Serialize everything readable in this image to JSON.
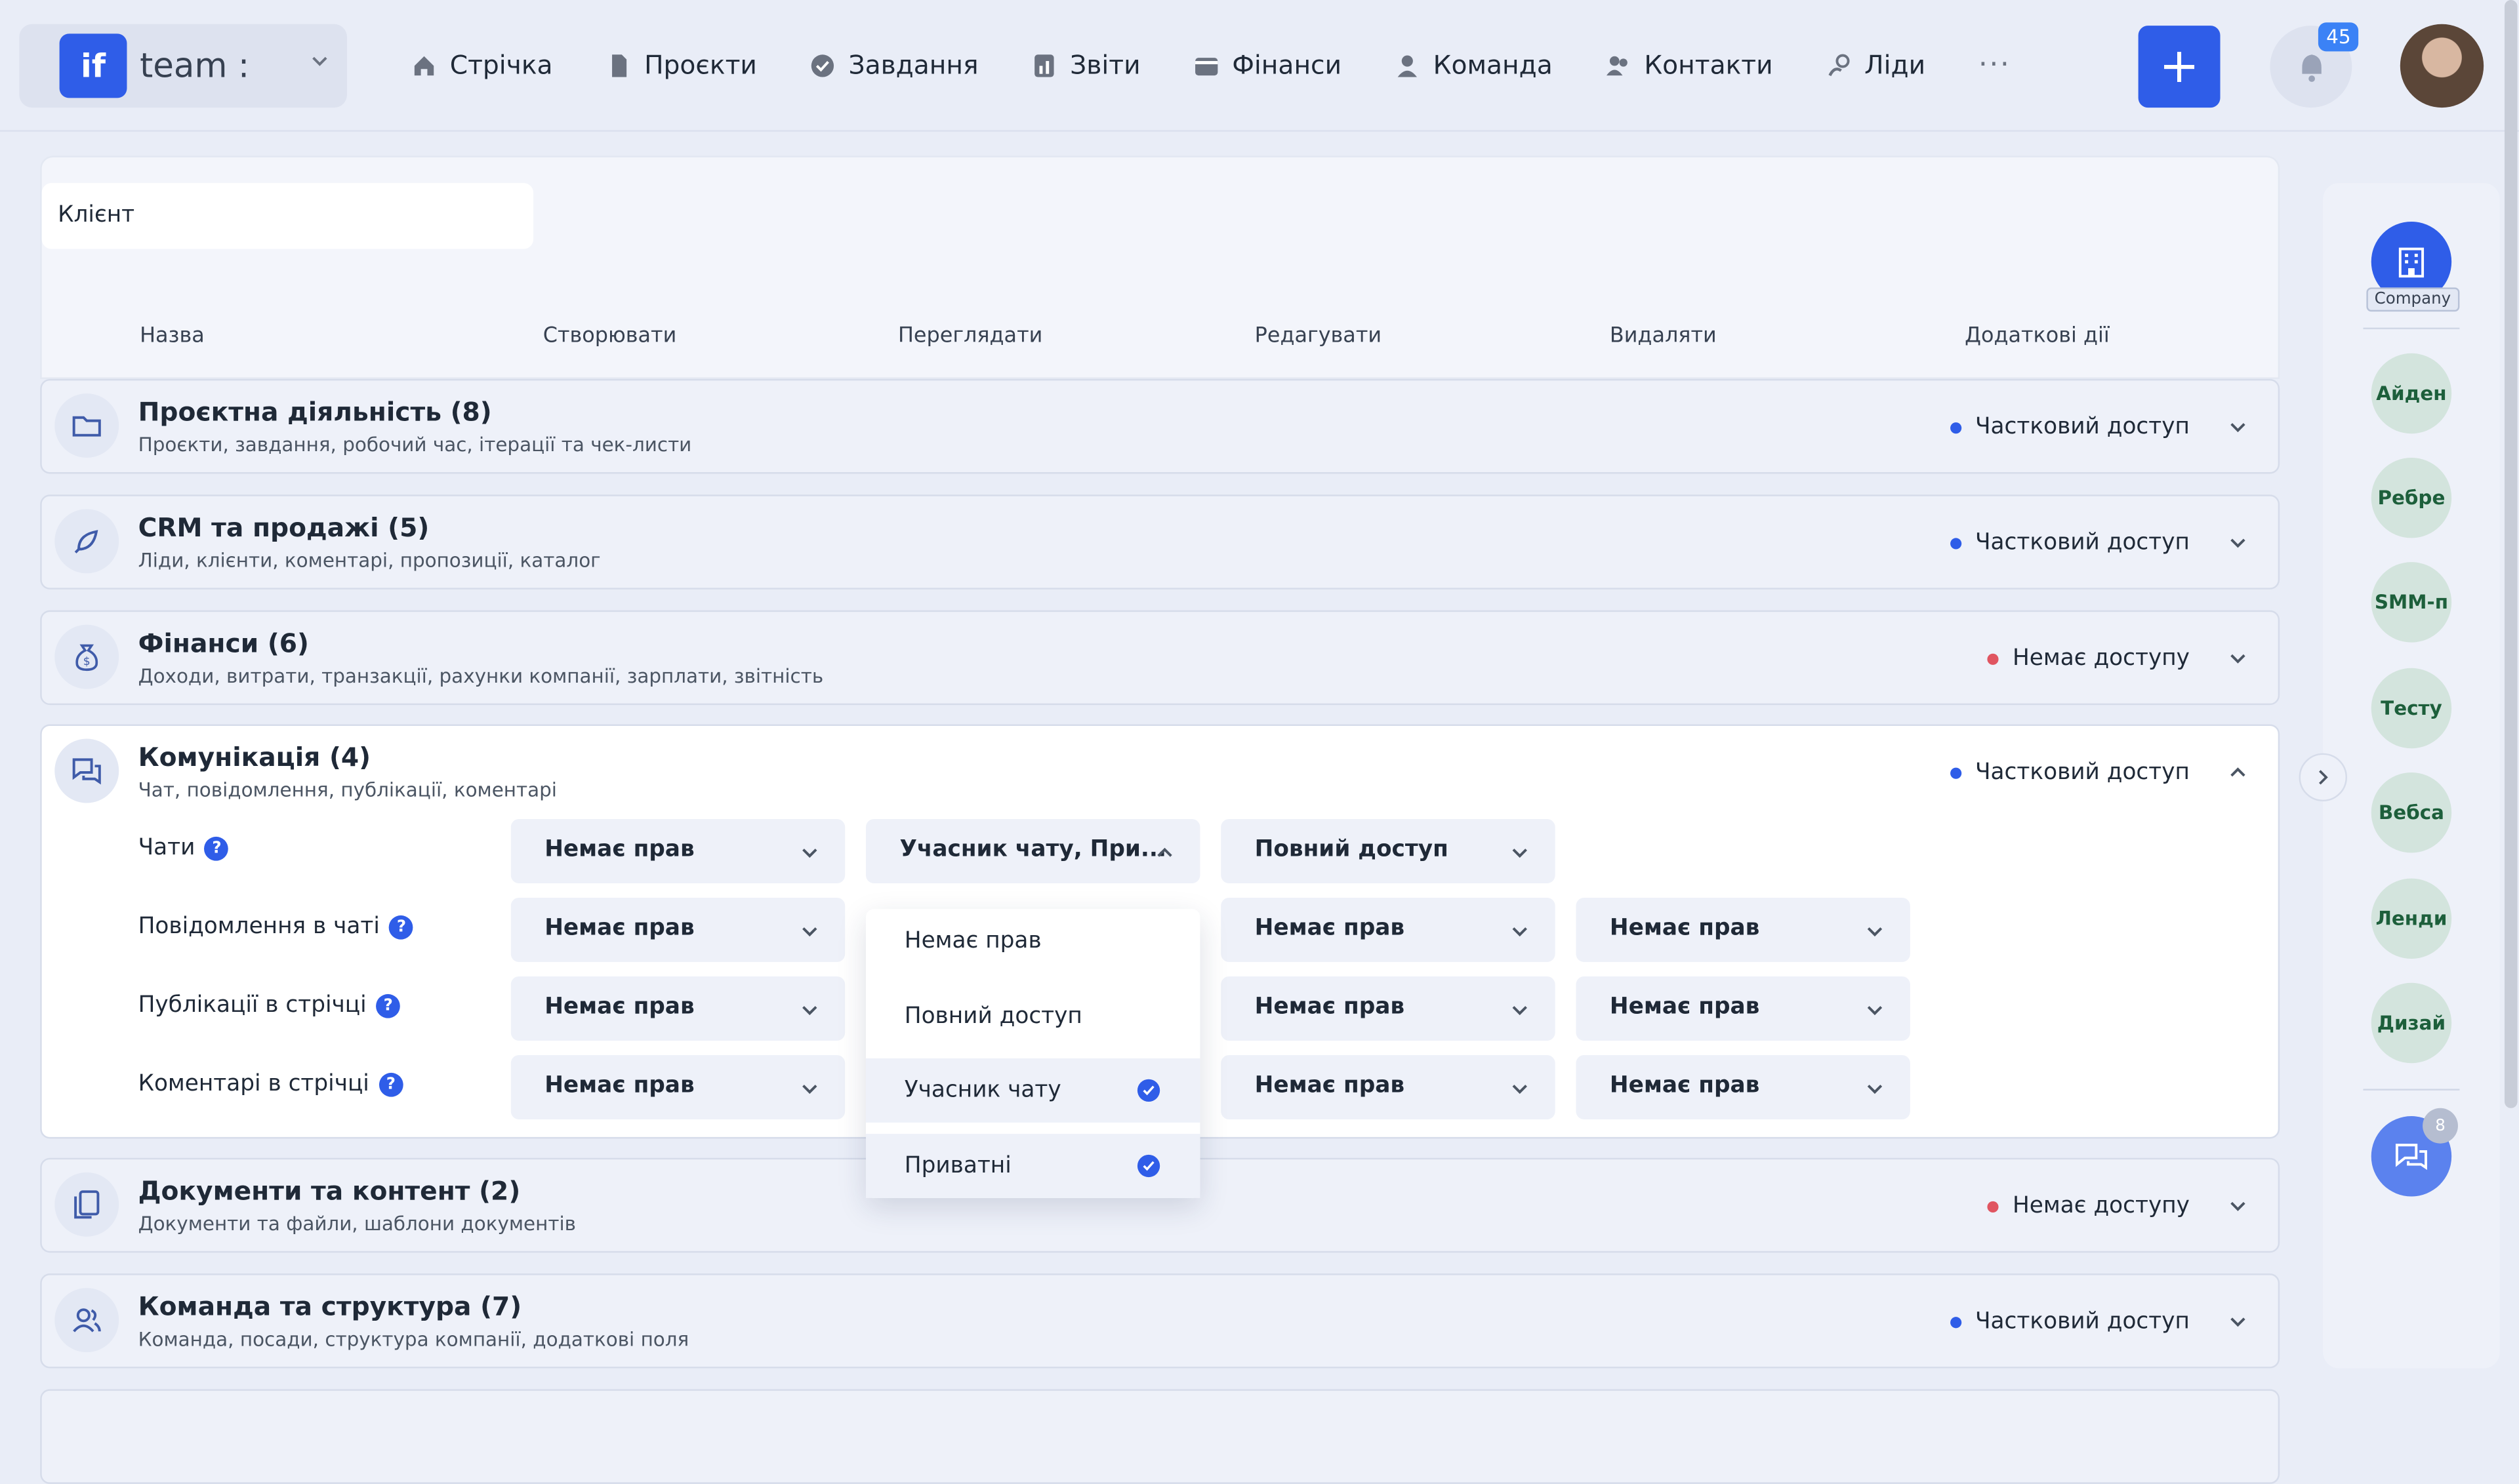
{
  "topbar": {
    "brand_text": "team :",
    "logo_text": "if",
    "nav": [
      {
        "label": "Стрічка",
        "icon": "home-icon"
      },
      {
        "label": "Проєкти",
        "icon": "document-icon"
      },
      {
        "label": "Завдання",
        "icon": "check-circle-icon"
      },
      {
        "label": "Звіти",
        "icon": "report-icon"
      },
      {
        "label": "Фінанси",
        "icon": "wallet-icon"
      },
      {
        "label": "Команда",
        "icon": "user-icon"
      },
      {
        "label": "Контакти",
        "icon": "contacts-icon"
      },
      {
        "label": "Ліди",
        "icon": "leads-icon"
      }
    ],
    "more": "···",
    "add_label": "+",
    "notifications_count": "45"
  },
  "panel": {
    "client_label": "Клієнт",
    "columns": [
      "Назва",
      "Створювати",
      "Переглядати",
      "Редагувати",
      "Видаляти",
      "Додаткові дії"
    ]
  },
  "sections": [
    {
      "title": "Проєктна діяльність (8)",
      "subtitle": "Проєкти, завдання, робочий час, ітерації та чек-листи",
      "status": "Частковий доступ",
      "icon": "folder-icon"
    },
    {
      "title": "CRM та продажі (5)",
      "subtitle": "Ліди, клієнти, коментарі, пропозиції, каталог",
      "status": "Частковий доступ",
      "icon": "rocket-icon"
    },
    {
      "title": "Фінанси (6)",
      "subtitle": "Доходи, витрати, транзакції, рахунки компанії, зарплати, звітність",
      "status": "Немає доступу",
      "icon": "money-bag-icon"
    },
    {
      "title": "Комунікація (4)",
      "subtitle": "Чат, повідомлення, публікації, коментарі",
      "status": "Частковий доступ",
      "icon": "chat-icon"
    },
    {
      "title": "Документи та контент (2)",
      "subtitle": "Документи та файли, шаблони документів",
      "status": "Немає доступу",
      "icon": "documents-icon"
    },
    {
      "title": "Команда та структура (7)",
      "subtitle": "Команда, посади, структура компанії, додаткові поля",
      "status": "Частковий доступ",
      "icon": "team-icon"
    }
  ],
  "communication": {
    "rows": [
      {
        "label": "Чати",
        "create": "Немає прав",
        "view": "Учасник чату, При...",
        "edit": "Повний доступ",
        "delete": ""
      },
      {
        "label": "Повідомлення в чаті",
        "create": "Немає прав",
        "view": "",
        "edit": "Немає прав",
        "delete": "Немає прав"
      },
      {
        "label": "Публікації в стрічці",
        "create": "Немає прав",
        "view": "",
        "edit": "Немає прав",
        "delete": "Немає прав"
      },
      {
        "label": "Коментарі в стрічці",
        "create": "Немає прав",
        "view": "",
        "edit": "Немає прав",
        "delete": "Немає прав"
      }
    ],
    "help_mark": "?",
    "dropdown_options": [
      {
        "label": "Немає прав",
        "checked": false
      },
      {
        "label": "Повний доступ",
        "checked": false
      },
      {
        "label": "Учасник чату",
        "checked": true
      },
      {
        "label": "Приватні",
        "checked": true
      }
    ]
  },
  "rail": {
    "company_label": "Company",
    "members": [
      "Айден",
      "Ребре",
      "SMM-п",
      "Тесту",
      "Вебса",
      "Ленди",
      "Дизай"
    ],
    "chat_badge": "8"
  },
  "colors": {
    "accent": "#2f5de8",
    "partial_dot": "#2f5de8",
    "none_dot": "#e05561"
  }
}
